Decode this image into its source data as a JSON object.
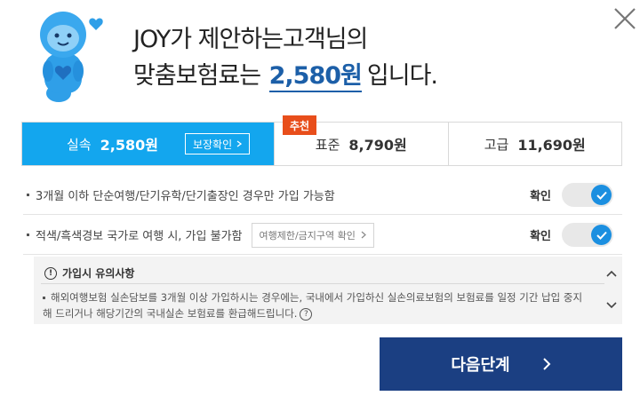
{
  "header": {
    "title_line1": "JOY가 제안하는고객님의",
    "title_line2_prefix": "맞춤보험료는",
    "title_price": "2,580원",
    "title_line2_suffix": "입니다."
  },
  "plans": [
    {
      "name": "실속",
      "price": "2,580원",
      "selected": true,
      "coverage_button": "보장확인"
    },
    {
      "name": "표준",
      "price": "8,790원",
      "selected": false,
      "badge": "추천"
    },
    {
      "name": "고급",
      "price": "11,690원",
      "selected": false
    }
  ],
  "notices": [
    {
      "text": "3개월 이하 단순여행/단기유학/단기출장인 경우만 가입 가능함",
      "confirm_label": "확인",
      "checked": true
    },
    {
      "text": "적색/흑색경보 국가로 여행 시, 가입 불가함",
      "link_button": "여행제한/금지구역 확인",
      "confirm_label": "확인",
      "checked": true
    }
  ],
  "caution": {
    "title": "가입시 유의사항",
    "text": "해외여행보험 실손담보를 3개월 이상 가입하시는 경우에는, 국내에서 가입하신 실손의료보험의 보험료를 일정 기간 납입 중지해 드리거나 해당기간의 국내실손 보험료를 환급해드립니다."
  },
  "next_button": {
    "label": "다음단계"
  },
  "colors": {
    "selected_plan": "#13a6ee",
    "badge": "#e84e1b",
    "primary_button": "#1b3f82",
    "toggle_on": "#1b8fe0",
    "price_highlight": "#1c5fa8"
  },
  "icons": {
    "mascot": "joy-mascot-icon",
    "close": "close-icon",
    "chevron": "chevron-right-icon",
    "check": "check-icon",
    "info": "info-icon",
    "help": "help-icon"
  }
}
